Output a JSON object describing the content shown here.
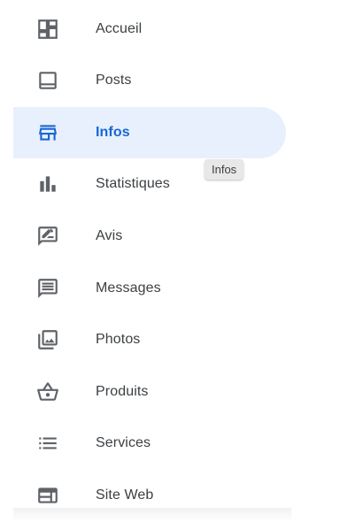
{
  "nav": {
    "items": [
      {
        "label": "Accueil",
        "icon": "dashboard-icon",
        "active": false
      },
      {
        "label": "Posts",
        "icon": "posts-icon",
        "active": false
      },
      {
        "label": "Infos",
        "icon": "storefront-icon",
        "active": true
      },
      {
        "label": "Statistiques",
        "icon": "bar-chart-icon",
        "active": false
      },
      {
        "label": "Avis",
        "icon": "rate-review-icon",
        "active": false
      },
      {
        "label": "Messages",
        "icon": "message-icon",
        "active": false
      },
      {
        "label": "Photos",
        "icon": "photo-library-icon",
        "active": false
      },
      {
        "label": "Produits",
        "icon": "shopping-basket-icon",
        "active": false
      },
      {
        "label": "Services",
        "icon": "list-icon",
        "active": false
      },
      {
        "label": "Site Web",
        "icon": "web-icon",
        "active": false
      }
    ]
  },
  "tooltip": {
    "text": "Infos"
  },
  "colors": {
    "active_background": "#e8f0fe",
    "active_accent": "#1967d2",
    "icon_default": "#5f6368",
    "text_default": "#3c4043"
  }
}
